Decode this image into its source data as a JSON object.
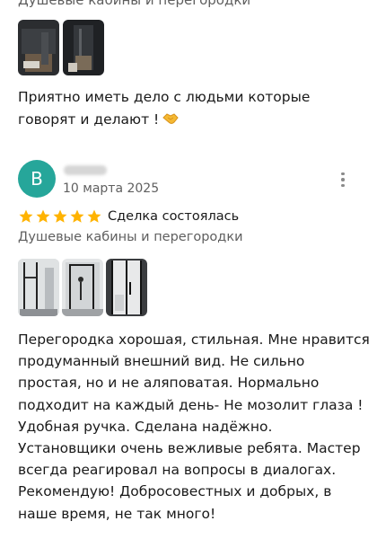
{
  "previous_review": {
    "category": "Душевые кабины и перегородки",
    "text": "Приятно иметь дело с людьми которые говорят и делают !",
    "emoji_icon": "handshake-icon"
  },
  "review": {
    "avatar_letter": "B",
    "avatar_color": "#26a69a",
    "date": "10 марта 2025",
    "rating": 5,
    "deal_status": "Сделка состоялась",
    "category": "Душевые кабины и перегородки",
    "photo_count": 3,
    "text": "Перегородка хорошая, стильная. Мне нравится продуманный внешний вид. Не сильно простая, но и не аляповатая. Нормально подходит на каждый день- Не мозолит глаза ! Удобная ручка. Сделана надёжно.\nУстановщики очень вежливые ребята. Мастер всегда реагировал на вопросы в диалогах. Рекомендую! Добросовестных и добрых, в наше время, не так много!"
  },
  "colors": {
    "star": "#ffb300",
    "secondary_text": "#5f5f5f",
    "primary_text": "#1a1a1a"
  },
  "icons": [
    "more-vert-icon",
    "star-icon",
    "handshake-icon"
  ]
}
